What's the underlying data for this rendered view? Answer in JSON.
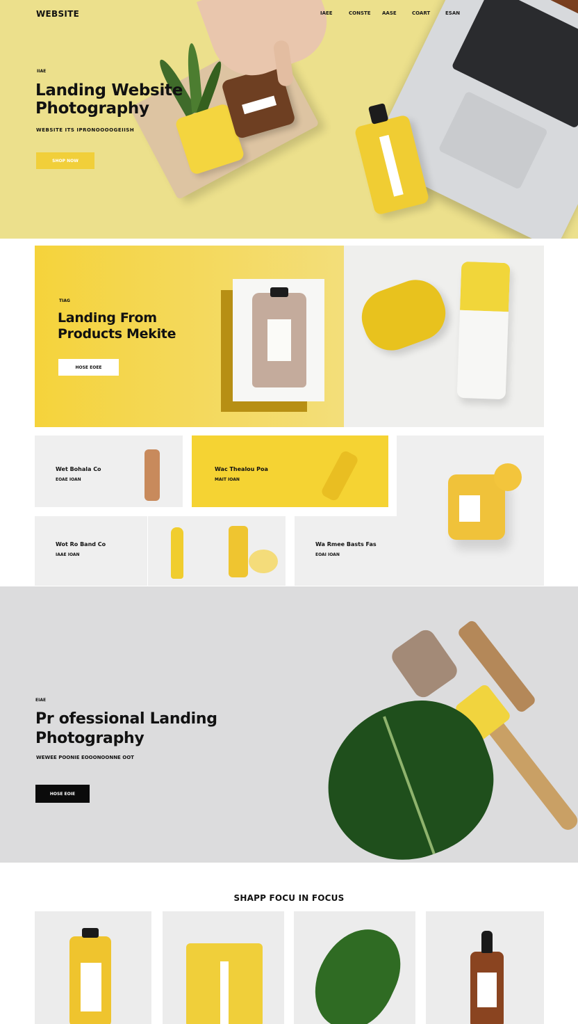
{
  "header": {
    "logo": "WEBSITE",
    "nav": [
      "IAEE",
      "CONSTE",
      "AASE",
      "COART",
      "ESAN"
    ]
  },
  "hero": {
    "tag": "IIAE",
    "title": "Landing Website Photography",
    "subtitle": "WEBSITE ITS IPRONOOOOGEIISH",
    "button": "SHOP NOW"
  },
  "feature": {
    "tag": "TIAG",
    "title": "Landing From Products Mekite",
    "button": "HOSE EOEE"
  },
  "products": [
    {
      "title": "Wet Bohala Co",
      "sub": "EOAE IOAN"
    },
    {
      "title": "Wac Thealou Poa",
      "sub": "MAIT IOAN"
    },
    {
      "title": "Wot Ro Band Co",
      "sub": "IAAE IOAN"
    },
    {
      "title": "Wa Rmee Basts Fas",
      "sub": "EOAI IOAN"
    }
  ],
  "professional": {
    "tag": "EIAE",
    "title": "Pr ofessional Landing Photography",
    "subtitle": "WEWEE POONIE EOOONOONNE OOT",
    "button": "HOSE EOIE"
  },
  "focus": {
    "title": "SHAPP FOCU IN FOCUS"
  },
  "colors": {
    "hero_bg": "#ece08c",
    "accent_yellow": "#f5d333",
    "grey_bg": "#dcdcdd",
    "black": "#0b0b0b"
  }
}
